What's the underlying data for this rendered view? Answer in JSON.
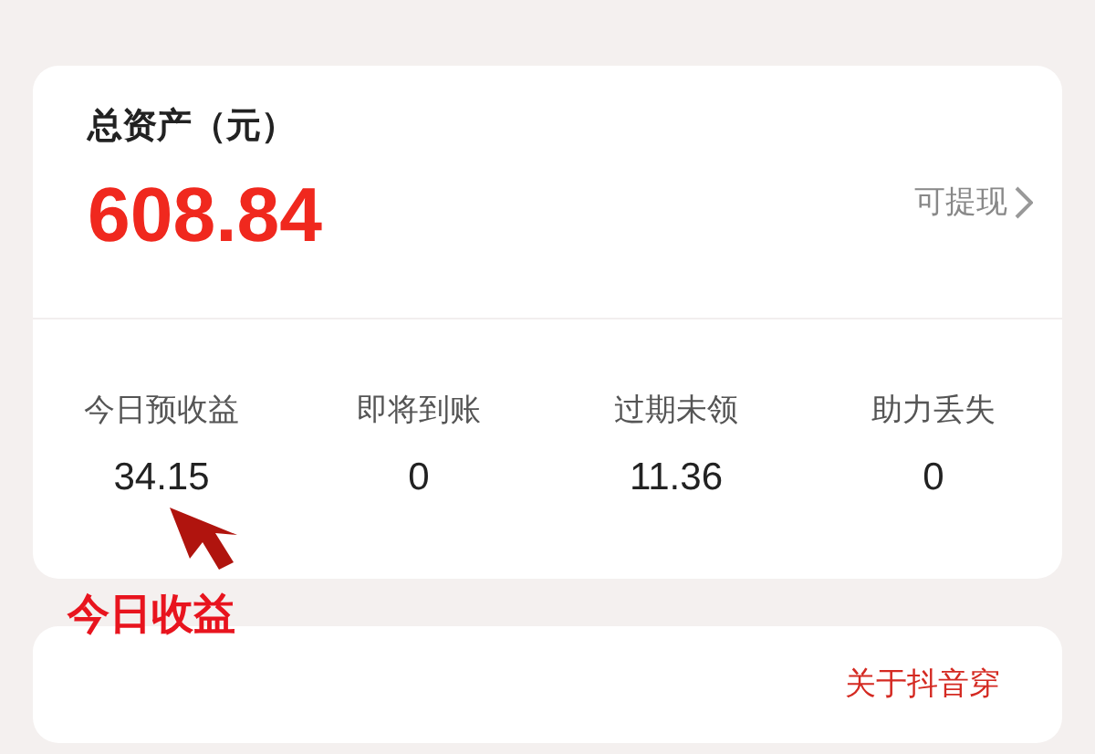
{
  "assets": {
    "title": "总资产（元）",
    "amount": "608.84",
    "withdraw": "可提现"
  },
  "stats": [
    {
      "label": "今日预收益",
      "value": "34.15"
    },
    {
      "label": "即将到账",
      "value": "0"
    },
    {
      "label": "过期未领",
      "value": "11.36"
    },
    {
      "label": "助力丢失",
      "value": "0"
    }
  ],
  "annotation": {
    "text": "今日收益"
  },
  "link_card": {
    "text": "关于抖音穿"
  }
}
